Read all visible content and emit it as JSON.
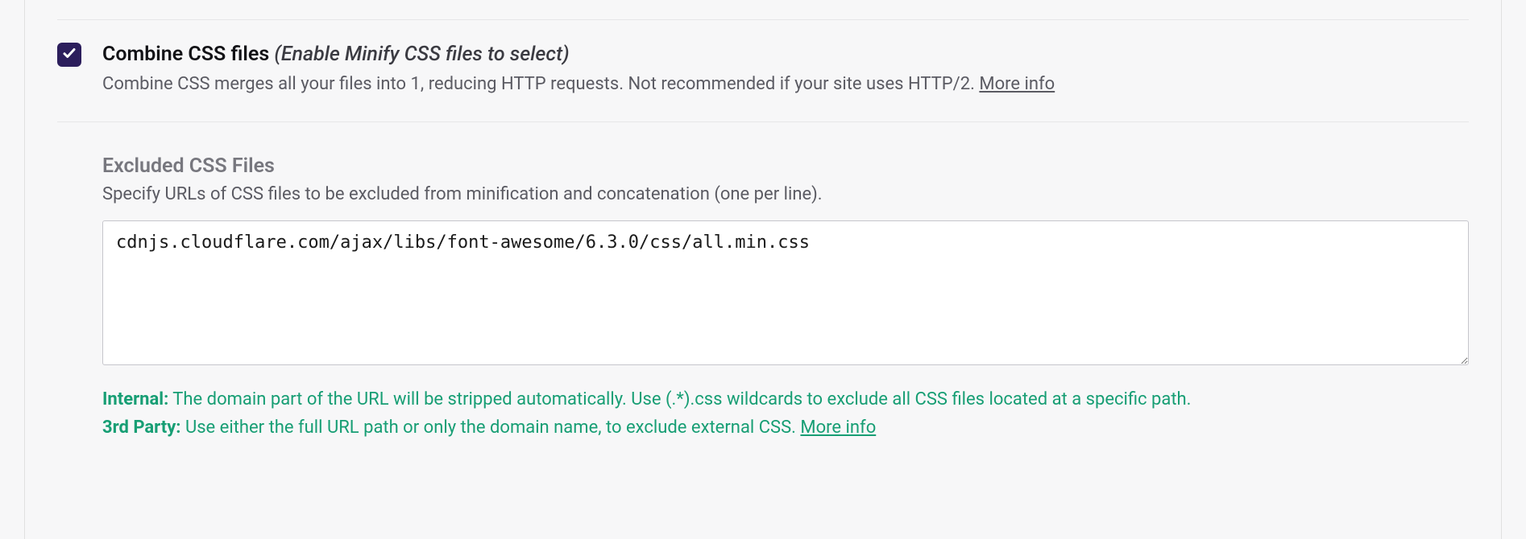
{
  "option": {
    "checked": true,
    "title": "Combine CSS files",
    "hint": "(Enable Minify CSS files to select)",
    "description_prefix": "Combine CSS merges all your files into 1, reducing HTTP requests. Not recommended if your site uses HTTP/2. ",
    "more_info": "More info"
  },
  "excluded": {
    "title": "Excluded CSS Files",
    "description": "Specify URLs of CSS files to be excluded from minification and concatenation (one per line).",
    "value": "cdnjs.cloudflare.com/ajax/libs/font-awesome/6.3.0/css/all.min.css"
  },
  "notes": {
    "internal_label": "Internal:",
    "internal_text": " The domain part of the URL will be stripped automatically. Use (.*).css wildcards to exclude all CSS files located at a specific path.",
    "third_party_label": "3rd Party:",
    "third_party_text": " Use either the full URL path or only the domain name, to exclude external CSS. ",
    "more_info": "More info"
  }
}
